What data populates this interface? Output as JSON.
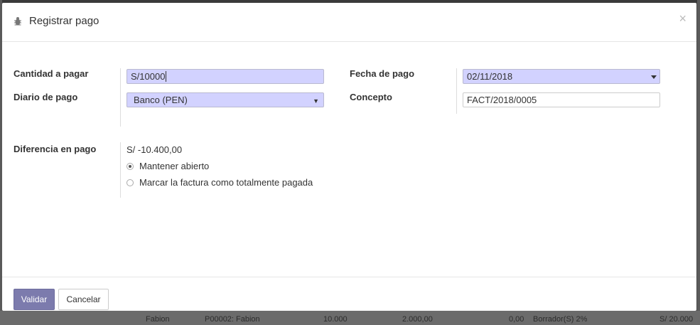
{
  "dialog": {
    "title": "Registrar pago",
    "close_symbol": "×"
  },
  "form": {
    "amount_label": "Cantidad a pagar",
    "amount_value": "S/10000",
    "journal_label": "Diario de pago",
    "journal_value": "Banco (PEN)",
    "date_label": "Fecha de pago",
    "date_value": "02/11/2018",
    "memo_label": "Concepto",
    "memo_value": "FACT/2018/0005",
    "difference_label": "Diferencia en pago",
    "difference_value": "S/ -10.400,00",
    "options": [
      {
        "label": "Mantener abierto",
        "checked": true
      },
      {
        "label": "Marcar la factura como totalmente pagada",
        "checked": false
      }
    ]
  },
  "footer": {
    "validate_label": "Validar",
    "cancel_label": "Cancelar"
  },
  "background": {
    "row_cells": [
      "Fabion",
      "P00002: Fabion",
      "10.000",
      "2.000,00",
      "0,00",
      "Borrador(S) 2%",
      "S/ 20.000"
    ]
  },
  "colors": {
    "accent": "#7c7bad",
    "input_highlight": "#d2d2ff"
  },
  "icons": {
    "title_icon": "bug-icon",
    "close": "close-icon",
    "dropdown": "caret-down-icon"
  }
}
